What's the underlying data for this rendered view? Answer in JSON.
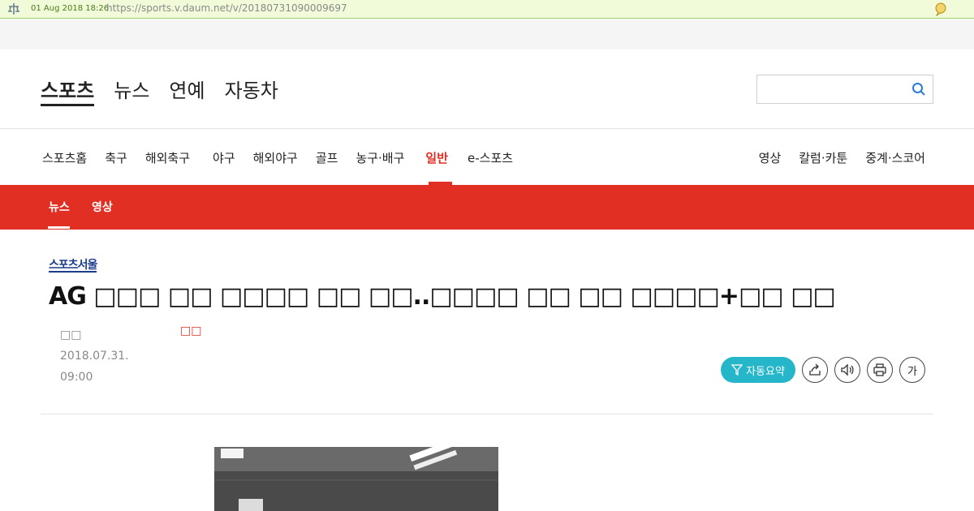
{
  "archive": {
    "date": "01 Aug 2018 18:26",
    "url": "https://sports.v.daum.net/v/20180731090009697"
  },
  "top_nav": [
    "스포츠",
    "뉴스",
    "연예",
    "자동차"
  ],
  "gnb": {
    "items": [
      "스포츠홈",
      "축구",
      "해외축구",
      "야구",
      "해외야구",
      "골프",
      "농구·배구",
      "일반",
      "e-스포츠"
    ],
    "active": "일반",
    "right_items": [
      "영상",
      "칼럼·카툰",
      "중계·스코어"
    ]
  },
  "subnav": [
    "뉴스",
    "영상"
  ],
  "article": {
    "publisher": "스포츠서울",
    "title": "AG □□□ □□ □□□□ □□ □□..□□□□ □□ □□ □□□□+□□ □□",
    "date_label": "□□",
    "date": "2018.07.31.",
    "time": "09:00",
    "author": "□□"
  },
  "tools": {
    "summary_label": "자동요약",
    "font_label": "가"
  },
  "colors": {
    "accent": "#e13023",
    "summary": "#25b7c9",
    "publisher": "#1c3c8c"
  }
}
